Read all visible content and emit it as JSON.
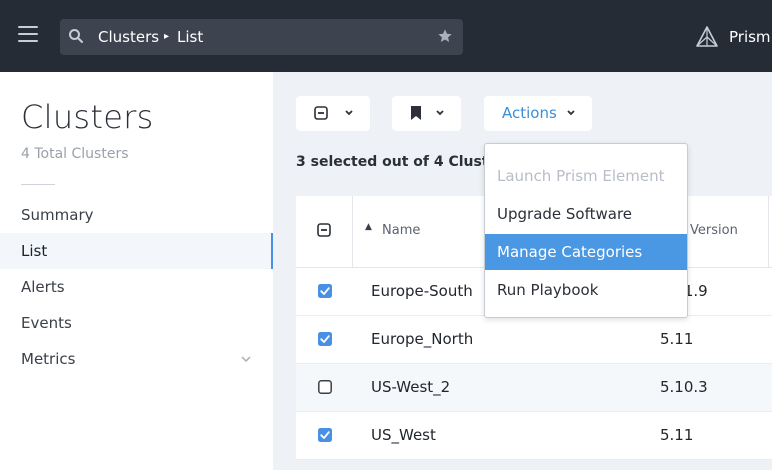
{
  "header": {
    "breadcrumb": [
      "Clusters",
      "List"
    ],
    "breadcrumb_separator": "▸",
    "brand_name": "Prism",
    "brand_icon": "prism-logo-icon",
    "search_icon": "search-icon",
    "favorite_icon": "star-icon"
  },
  "sidebar": {
    "title": "Clusters",
    "subtitle": "4 Total Clusters",
    "items": [
      {
        "label": "Summary",
        "active": false
      },
      {
        "label": "List",
        "active": true
      },
      {
        "label": "Alerts",
        "active": false
      },
      {
        "label": "Events",
        "active": false
      },
      {
        "label": "Metrics",
        "active": false,
        "expandable": true
      }
    ]
  },
  "toolbar": {
    "select_menu_icon": "select-partial-icon",
    "bookmark_menu_icon": "bookmark-icon",
    "actions_label": "Actions",
    "dropdown_glyph": "⌄"
  },
  "selection_status": "3 selected out of 4 Clusters",
  "table": {
    "columns": {
      "sort_indicator": "▲",
      "name": "Name",
      "version": "Version"
    },
    "rows": [
      {
        "name": "Europe-South",
        "version": "5.11.9",
        "checked": true
      },
      {
        "name": "Europe_North",
        "version": "5.11",
        "checked": true
      },
      {
        "name": "US-West_2",
        "version": "5.10.3",
        "checked": false
      },
      {
        "name": "US_West",
        "version": "5.11",
        "checked": true
      }
    ]
  },
  "actions_menu": {
    "items": [
      {
        "label": "Launch Prism Element",
        "disabled": true
      },
      {
        "label": "Upgrade Software",
        "disabled": false
      },
      {
        "label": "Manage Categories",
        "disabled": false,
        "highlighted": true
      },
      {
        "label": "Run Playbook",
        "disabled": false
      }
    ]
  },
  "colors": {
    "topbar": "#262c36",
    "accent": "#4a90e2",
    "menu_highlight": "#4a97e3",
    "page_bg": "#eef1f5"
  }
}
